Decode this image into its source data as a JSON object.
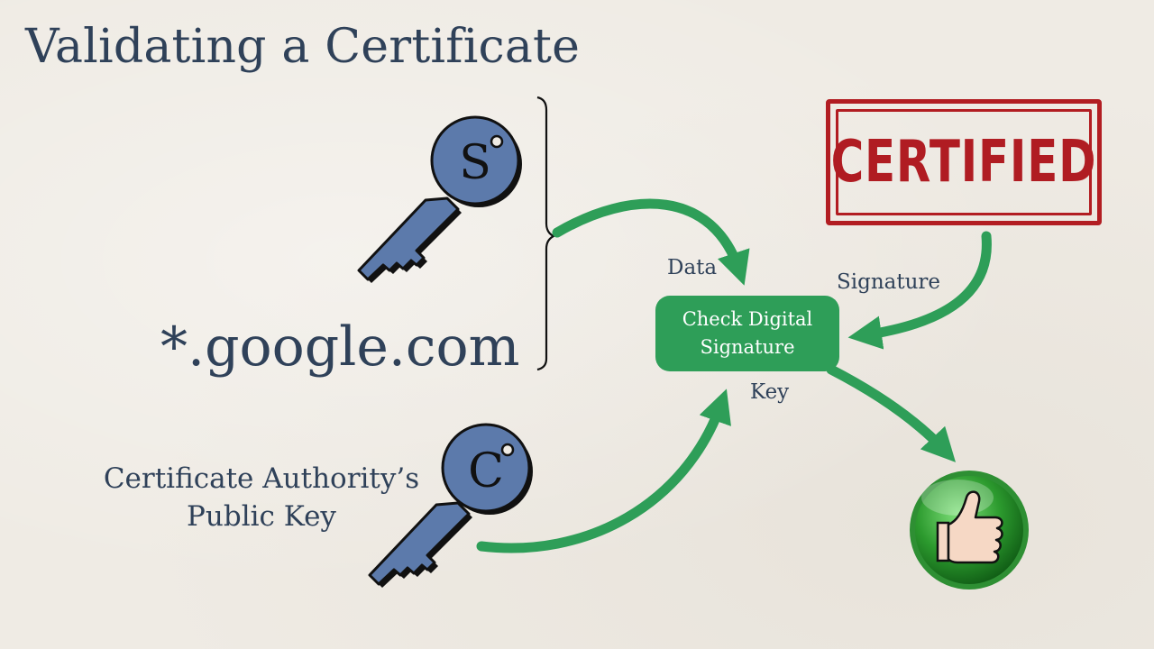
{
  "slide": {
    "title": "Validating a Certificate",
    "domain_name": "*.google.com",
    "ca_label_line1": "Certificate Authority’s",
    "ca_label_line2": "Public Key",
    "server_key_letter": "S",
    "ca_key_letter": "C",
    "stamp_text": "CERTIFIED"
  },
  "process": {
    "line1": "Check Digital",
    "line2": "Signature"
  },
  "edges": {
    "data_label": "Data",
    "signature_label": "Signature",
    "key_label": "Key"
  },
  "colors": {
    "text": "#2f4159",
    "key_fill": "#5c7aab",
    "arrow": "#2e9e58",
    "stamp_red": "#b21d22",
    "thumbs_green": "#1f8a25"
  }
}
